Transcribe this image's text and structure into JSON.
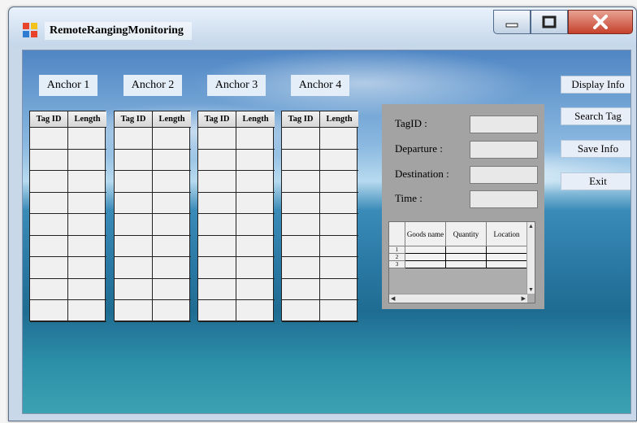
{
  "window": {
    "title": "RemoteRangingMonitoring",
    "controls": {
      "minimize": "minimize-icon",
      "maximize": "maximize-icon",
      "close": "close-icon"
    }
  },
  "anchors": [
    {
      "label": "Anchor 1",
      "col1": "Tag ID",
      "col2": "Length"
    },
    {
      "label": "Anchor 2",
      "col1": "Tag ID",
      "col2": "Length"
    },
    {
      "label": "Anchor 3",
      "col1": "Tag ID",
      "col2": "Length"
    },
    {
      "label": "Anchor 4",
      "col1": "Tag ID",
      "col2": "Length"
    }
  ],
  "buttons": {
    "display_info": "Display Info",
    "search_tag": "Search Tag",
    "save_info": "Save Info",
    "exit": "Exit"
  },
  "info_panel": {
    "tagid_label": "TagID :",
    "departure_label": "Departure :",
    "destination_label": "Destination :",
    "time_label": "Time :",
    "tagid_value": "",
    "departure_value": "",
    "destination_value": "",
    "time_value": ""
  },
  "goods_table": {
    "columns": [
      "Goods name",
      "Quantity",
      "Location"
    ],
    "rows": [
      "1",
      "2",
      "3"
    ]
  },
  "colors": {
    "title_close": "#c5412c",
    "panel_gray": "#a3a3a3",
    "button_bg": "#e7eef8"
  }
}
